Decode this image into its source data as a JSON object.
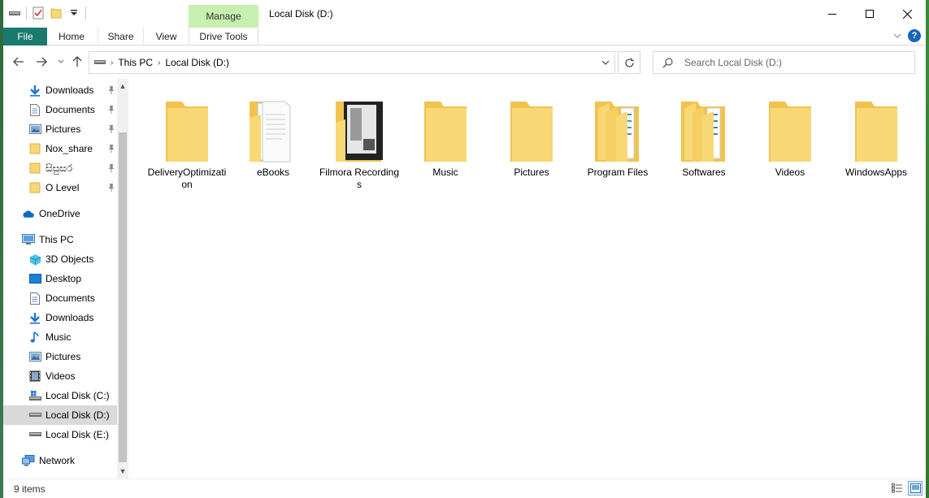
{
  "window": {
    "title": "Local Disk (D:)",
    "manage_label": "Manage"
  },
  "ribbon": {
    "tabs": [
      "File",
      "Home",
      "Share",
      "View",
      "Drive Tools"
    ]
  },
  "address": {
    "crumbs": [
      "This PC",
      "Local Disk (D:)"
    ]
  },
  "search": {
    "placeholder": "Search Local Disk (D:)"
  },
  "nav": {
    "quick_access": [
      {
        "label": "Downloads",
        "icon": "downloads-icon",
        "pinned": true
      },
      {
        "label": "Documents",
        "icon": "documents-icon",
        "pinned": true
      },
      {
        "label": "Pictures",
        "icon": "pictures-icon",
        "pinned": true
      },
      {
        "label": "Nox_share",
        "icon": "folder-icon",
        "pinned": true
      },
      {
        "label": "සිසුසර",
        "icon": "folder-icon",
        "pinned": true
      },
      {
        "label": "O Level",
        "icon": "folder-icon",
        "pinned": true
      }
    ],
    "onedrive": "OneDrive",
    "this_pc": "This PC",
    "pc_items": [
      {
        "label": "3D Objects",
        "icon": "3d-objects-icon"
      },
      {
        "label": "Desktop",
        "icon": "desktop-icon"
      },
      {
        "label": "Documents",
        "icon": "documents-icon"
      },
      {
        "label": "Downloads",
        "icon": "downloads-icon"
      },
      {
        "label": "Music",
        "icon": "music-icon"
      },
      {
        "label": "Pictures",
        "icon": "pictures-icon"
      },
      {
        "label": "Videos",
        "icon": "videos-icon"
      },
      {
        "label": "Local Disk (C:)",
        "icon": "drive-c-icon"
      },
      {
        "label": "Local Disk (D:)",
        "icon": "drive-icon",
        "selected": true
      },
      {
        "label": "Local Disk (E:)",
        "icon": "drive-icon"
      }
    ],
    "network": "Network"
  },
  "files": [
    {
      "name": "DeliveryOptimization",
      "kind": "plain"
    },
    {
      "name": "eBooks",
      "kind": "docs"
    },
    {
      "name": "Filmora Recordings",
      "kind": "photo"
    },
    {
      "name": "Music",
      "kind": "plain"
    },
    {
      "name": "Pictures",
      "kind": "plain"
    },
    {
      "name": "Program Files",
      "kind": "stack"
    },
    {
      "name": "Softwares",
      "kind": "stack"
    },
    {
      "name": "Videos",
      "kind": "plain"
    },
    {
      "name": "WindowsApps",
      "kind": "plain"
    }
  ],
  "status": {
    "count": "9 items"
  },
  "colors": {
    "file_tab": "#1a7a6e",
    "manage_tab": "#c6efb0",
    "folder": "#f8d775",
    "selected_nav": "#d9d9d9"
  }
}
